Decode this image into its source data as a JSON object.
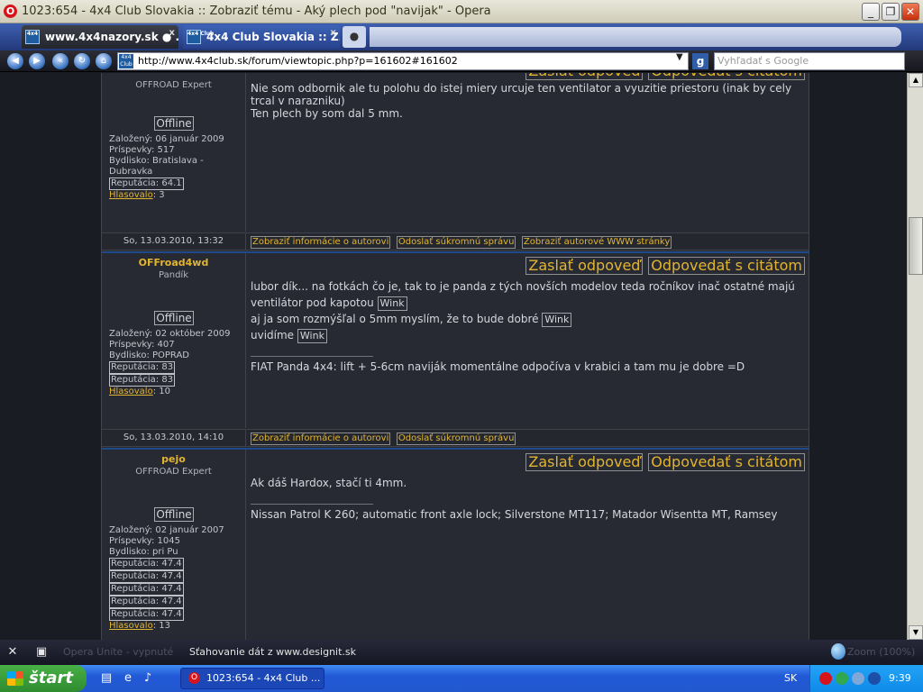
{
  "window": {
    "title": "1023:654 - 4x4 Club Slovakia :: Zobraziť tému - Aký plech pod \"navijak\" - Opera",
    "min_label": "_",
    "max_label": "❐",
    "close_label": "✕"
  },
  "tabs": [
    {
      "label": "www.4x4nazory.sk ● ...",
      "close": "x",
      "favicon_text": "4x4"
    },
    {
      "label": "4x4 Club Slovakia :: Z...",
      "close": "x",
      "favicon_text": "4x4 Club"
    }
  ],
  "newtab_label": "●",
  "nav": {
    "url": "http://www.4x4club.sk/forum/viewtopic.php?p=161602#161602",
    "search_placeholder": "Vyhľadať s Google",
    "search_engine": "g",
    "addr_favicon_text": "4x4 Club"
  },
  "posts": [
    {
      "rank": "OFFROAD Expert",
      "status": "Offline",
      "joined": "Založený: 06 január 2009",
      "posts": "Príspevky: 517",
      "location": "Bydlisko: Bratislava - Dubravka",
      "reputations": [
        "Reputácia: 64.1"
      ],
      "vote_label": "Hlasovalo",
      "vote_count": ": 3",
      "buttons": [
        "Zaslať odpoveď",
        "Odpovedať s citátom"
      ],
      "text_lines": [
        "Nie som odbornik ale tu polohu do istej miery urcuje ten ventilator a vyuzitie priestoru (inak by cely trcal v narazniku)",
        "Ten plech by som dal 5 mm."
      ],
      "footer_date": "So, 13.03.2010, 13:32",
      "footer_links": [
        "Zobraziť informácie o autorovi",
        "Odoslať súkromnú správu",
        "Zobraziť autorové WWW stránky"
      ]
    },
    {
      "username": "OFFroad4wd",
      "rank": "Pandík",
      "status": "Offline",
      "joined": "Založený: 02 október 2009",
      "posts": "Príspevky: 407",
      "location": "Bydlisko: POPRAD",
      "reputations": [
        "Reputácia: 83",
        "Reputácia: 83"
      ],
      "vote_label": "Hlasovalo",
      "vote_count": ": 10",
      "buttons": [
        "Zaslať odpoveď",
        "Odpovedať s citátom"
      ],
      "line1": "lubor dík... na fotkách čo je, tak to je panda z tých novších modelov teda ročníkov inač ostatné majú ventilátor pod kapotou",
      "line2": "aj ja som rozmýšľal o 5mm myslím, že to bude dobré",
      "line3": "uvidíme",
      "wink": "Wink",
      "signature": "FIAT Panda 4x4: lift + 5-6cm naviják momentálne odpočíva v krabici a tam mu je dobre =D",
      "footer_date": "So, 13.03.2010, 14:10",
      "footer_links": [
        "Zobraziť informácie o autorovi",
        "Odoslať súkromnú správu"
      ]
    },
    {
      "username": "pejo",
      "rank": "OFFROAD Expert",
      "status": "Offline",
      "joined": "Založený: 02 január 2007",
      "posts": "Príspevky: 1045",
      "location": "Bydlisko: pri Pu",
      "reputations": [
        "Reputácia: 47.4",
        "Reputácia: 47.4",
        "Reputácia: 47.4",
        "Reputácia: 47.4",
        "Reputácia: 47.4"
      ],
      "vote_label": "Hlasovalo",
      "vote_count": ": 13",
      "buttons": [
        "Zaslať odpoveď",
        "Odpovedať s citátom"
      ],
      "text": "Ak dáš Hardox, stačí ti 4mm.",
      "signature": "Nissan Patrol K 260; automatic front axle lock; Silverstone MT117; Matador Wisentta MT, Ramsey"
    }
  ],
  "statusbar": {
    "opera_status": "Opera Unite - vypnuté",
    "download": "Sťahovanie dát z www.designit.sk",
    "zoom": "Zoom (100%)"
  },
  "taskbar": {
    "start": "štart",
    "task": "1023:654 - 4x4 Club ...",
    "lang": "SK",
    "clock": "9:39"
  }
}
